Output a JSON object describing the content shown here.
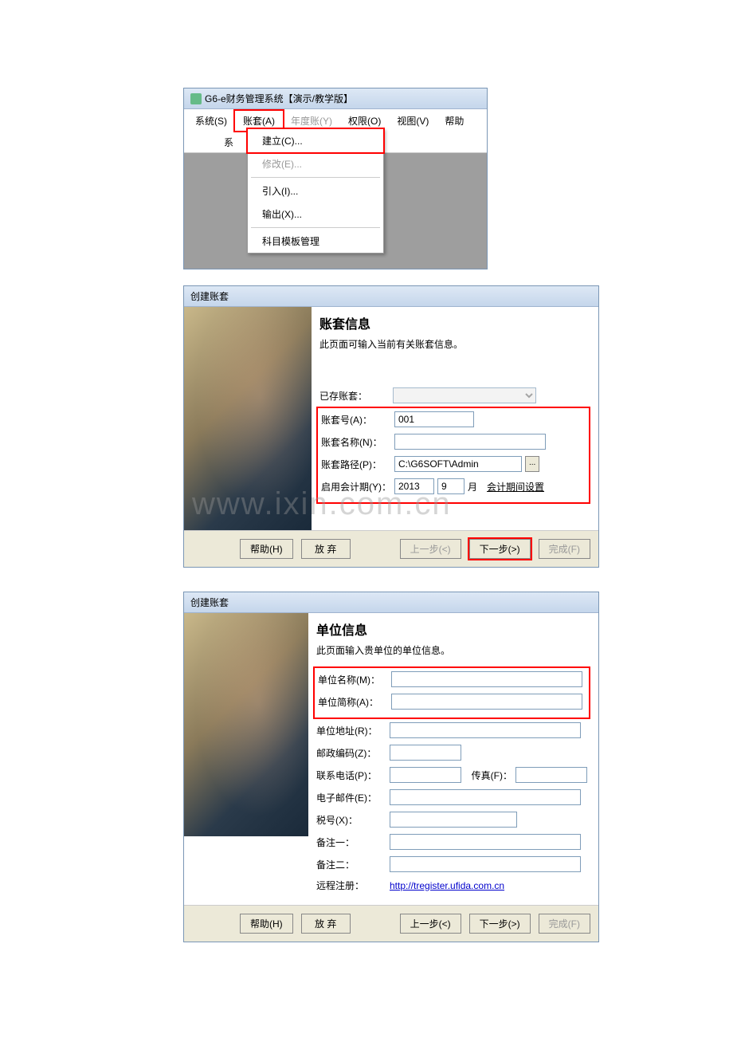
{
  "app": {
    "title": "G6-e财务管理系统【演示/教学版】",
    "menus": {
      "system": "系统(S)",
      "account": "账套(A)",
      "year": "年度账(Y)",
      "perm": "权限(O)",
      "view": "视图(V)",
      "help": "帮助"
    },
    "dropdown": {
      "create": "建立(C)...",
      "modify": "修改(E)...",
      "import": "引入(I)...",
      "export": "输出(X)...",
      "template": "科目模板管理"
    },
    "toolbar_fragment": "系"
  },
  "dlg1": {
    "title": "创建账套",
    "heading": "账套信息",
    "desc": "此页面可输入当前有关账套信息。",
    "existing_label": "已存账套：",
    "accno_label": "账套号(A)：",
    "accno_value": "001",
    "accname_label": "账套名称(N)：",
    "path_label": "账套路径(P)：",
    "path_value": "C:\\G6SOFT\\Admin",
    "period_label": "启用会计期(Y)：",
    "year_value": "2013",
    "month_value": "9",
    "month_suffix": "月",
    "period_btn": "会计期间设置",
    "browse": "...",
    "watermark": "www.ixin.com.cn"
  },
  "dlg2": {
    "title": "创建账套",
    "heading": "单位信息",
    "desc": "此页面输入贵单位的单位信息。",
    "name_label": "单位名称(M)：",
    "short_label": "单位简称(A)：",
    "addr_label": "单位地址(R)：",
    "zip_label": "邮政编码(Z)：",
    "tel_label": "联系电话(P)：",
    "fax_label": "传真(F)：",
    "email_label": "电子邮件(E)：",
    "tax_label": "税号(X)：",
    "note1_label": "备注一：",
    "note2_label": "备注二：",
    "reg_label": "远程注册：",
    "reg_url": "http://tregister.ufida.com.cn"
  },
  "buttons": {
    "help": "帮助(H)",
    "abandon": "放 弃",
    "prev": "上一步(<)",
    "next": "下一步(>)",
    "finish": "完成(F)"
  }
}
